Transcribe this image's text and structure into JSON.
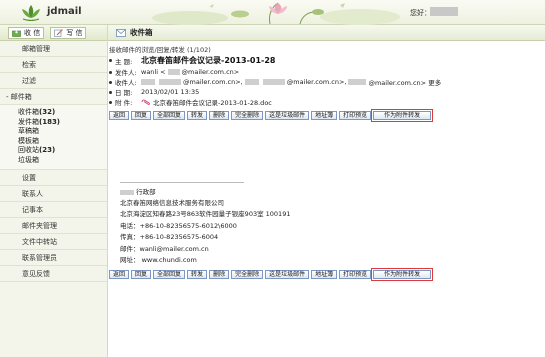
{
  "header": {
    "brand": "jdmail",
    "greeting": "您好："
  },
  "sidebar": {
    "quick": [
      {
        "label": "收 信",
        "icon": "inbox-receive-icon"
      },
      {
        "label": "写 信",
        "icon": "compose-icon"
      }
    ],
    "items_top": [
      "邮箱管理",
      "检索",
      "过滤"
    ],
    "mailbox_group": "- 邮件箱",
    "folders": [
      {
        "name": "收件箱",
        "count": "(32)"
      },
      {
        "name": "发件箱",
        "count": "(183)"
      },
      {
        "name": "草稿箱",
        "count": ""
      },
      {
        "name": "模板箱",
        "count": ""
      },
      {
        "name": "回收站",
        "count": "(23)"
      },
      {
        "name": "垃圾箱",
        "count": ""
      }
    ],
    "items_bottom": [
      "设置",
      "联系人",
      "记事本",
      "邮件夹管理",
      "文件中转站",
      "联系管理员",
      "意见反馈"
    ]
  },
  "main": {
    "title": "收件箱",
    "breadcrumb": "接收邮件的浏览/回复/转发 (1/102)",
    "subject_label": "主  题:",
    "subject": "北京春笛邮件会议记录-2013-01-28",
    "sender_label": "发件人:",
    "sender": "wanli <",
    "sender_domain": "@mailer.com.cn>",
    "recipient_label": "收件人:",
    "recipients": [
      "@mailer.com.cn>,",
      "@mailer.com.cn>,",
      "@mailer.com.cn> 更多"
    ],
    "date_label": "日  期:",
    "date": "2013/02/01 13:35",
    "attachment_label": "附  件:",
    "attachment": "北京春笛邮件会议记录-2013-01-28.doc",
    "toolbar": [
      "返回",
      "回复",
      "全部回复",
      "转发",
      "删除",
      "完全删除",
      "这是垃圾邮件",
      "地址簿",
      "打印预览",
      "作为附件转发"
    ],
    "signature": {
      "role": "行政部",
      "company": "北京春笛网络信息技术服务有限公司",
      "address": "北京海淀区知春路23号863软件园量子银座903室  100191",
      "phone": "电话：+86-10-82356575-6012\\6000",
      "fax": "传真：+86-10-82356575-6004",
      "email": "邮件：wanli@mailer.com.cn",
      "website": "网址：  www.chundi.com"
    }
  }
}
